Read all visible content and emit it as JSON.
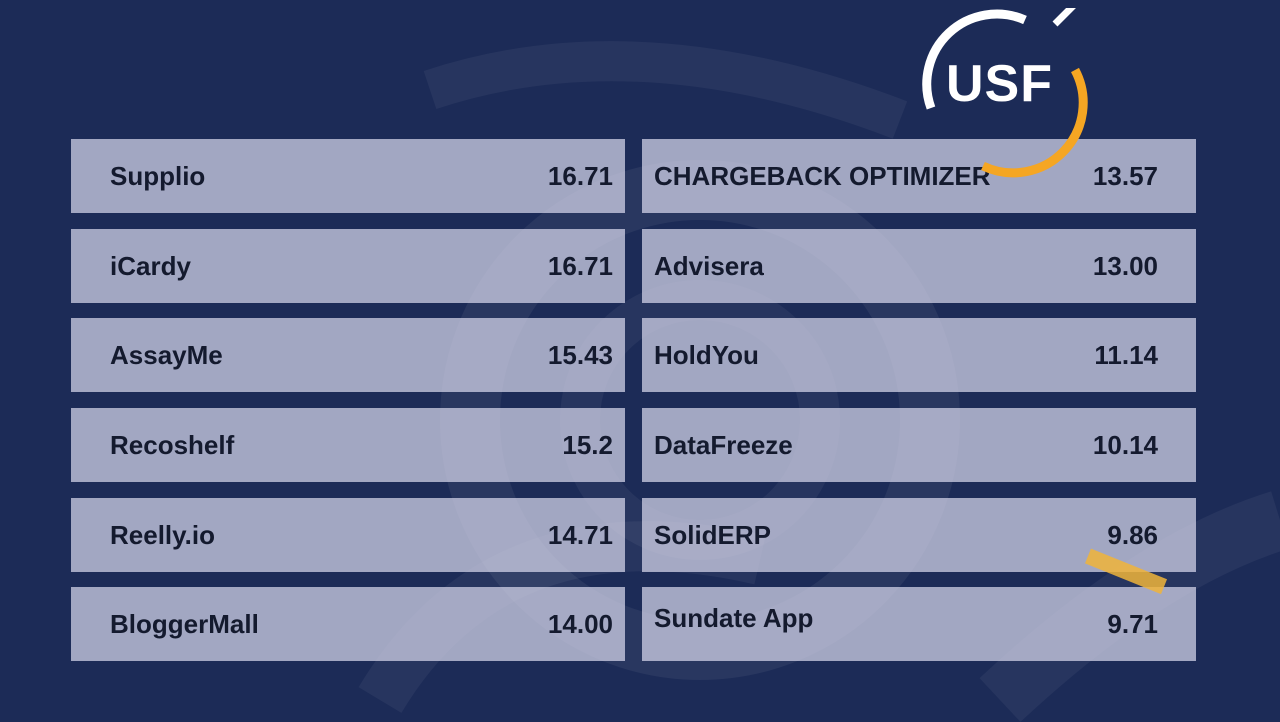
{
  "logo": {
    "text": "USF",
    "accent_color": "#f5a623"
  },
  "colors": {
    "background": "#1c2b57",
    "row": "#d7d7eb",
    "text": "#141a2e"
  },
  "left_column": [
    {
      "name": "Supplio",
      "score": "16.71"
    },
    {
      "name": "iCardy",
      "score": "16.71"
    },
    {
      "name": "AssayMe",
      "score": "15.43"
    },
    {
      "name": "Recoshelf",
      "score": "15.2"
    },
    {
      "name": "Reelly.io",
      "score": "14.71"
    },
    {
      "name": "BloggerMall",
      "score": "14.00"
    }
  ],
  "right_column": [
    {
      "name": "CHARGEBACK OPTIMIZER",
      "score": "13.57"
    },
    {
      "name": "Advisera",
      "score": "13.00"
    },
    {
      "name": "HoldYou",
      "score": "11.14"
    },
    {
      "name": "DataFreeze",
      "score": "10.14"
    },
    {
      "name": "SolidERP",
      "score": "9.86"
    },
    {
      "name": "Sundate App",
      "score": "9.71"
    }
  ]
}
